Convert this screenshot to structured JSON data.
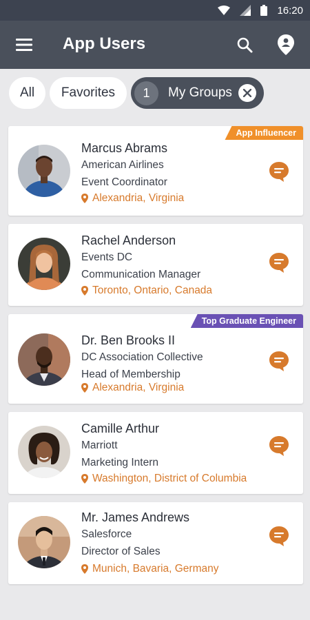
{
  "status_bar": {
    "time": "16:20"
  },
  "app_bar": {
    "title": "App Users"
  },
  "filters": {
    "all_label": "All",
    "favorites_label": "Favorites",
    "groups_count": "1",
    "groups_label": "My Groups"
  },
  "colors": {
    "accent_orange": "#d77a2c",
    "header": "#4a505b",
    "badge_orange": "#f0902a",
    "badge_purple": "#6a51b4"
  },
  "users": [
    {
      "name": "Marcus Abrams",
      "company": "American Airlines",
      "title": "Event Coordinator",
      "location": "Alexandria, Virginia",
      "badge": "App Influencer"
    },
    {
      "name": "Rachel Anderson",
      "company": "Events DC",
      "title": "Communication Manager",
      "location": "Toronto, Ontario, Canada",
      "badge": ""
    },
    {
      "name": "Dr. Ben Brooks II",
      "company": "DC Association Collective",
      "title": "Head of Membership",
      "location": "Alexandria, Virginia",
      "badge": "Top Graduate Engineer"
    },
    {
      "name": "Camille Arthur",
      "company": "Marriott",
      "title": "Marketing Intern",
      "location": "Washington, District of Columbia",
      "badge": ""
    },
    {
      "name": "Mr. James Andrews",
      "company": "Salesforce",
      "title": "Director of Sales",
      "location": "Munich, Bavaria, Germany",
      "badge": ""
    }
  ]
}
